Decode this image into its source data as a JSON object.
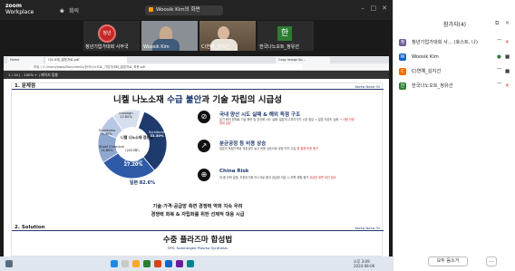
{
  "app": {
    "name": "zoom",
    "sub": "Workplace",
    "meeting_label": "회의"
  },
  "share": {
    "label": "Woosik Kim의 화면"
  },
  "videos": [
    {
      "caption": "청년기업가대회 사무국"
    },
    {
      "caption": "Woosik Kim"
    },
    {
      "caption": "C)연예_김지선"
    },
    {
      "caption": "한국나노오트_정유선",
      "initial": "한"
    }
  ],
  "browser": {
    "tabs": [
      "Home",
      "나노소재_발표자료.pdf",
      "Copy Image Sp..."
    ],
    "url": "파일 | C:/Users/papa/Documents/한국나노오트_기업가대회_발표자료_최종.pdf",
    "pdf_toolbar": "1 / 14   |   - 100% +   |   페이지 맞춤"
  },
  "slide": {
    "section1": "1. 문제점",
    "brand_logo": "Korea Nano Ot",
    "title_prefix": "니켈 나노소재 ",
    "title_hl": "수급 불안",
    "title_suffix": "과 기술 자립의 시급성",
    "donut": {
      "center_title": "니켈 나노소재 점유율",
      "center_sub": "(2023年)",
      "segments": [
        {
          "label": "Sumitomo",
          "value": "33.30%",
          "fraction": 0.333
        },
        {
          "label": "JFE Mineral",
          "value": "27.20%",
          "fraction": 0.272
        },
        {
          "label": "Shoei Chemical",
          "value": "14.80%",
          "fraction": 0.148
        },
        {
          "label": "Sumitomo",
          "value": "9.40%",
          "fraction": 0.094
        },
        {
          "label": "Luoyagn",
          "value": "13.60%",
          "fraction": 0.136
        }
      ],
      "japan_share": "일본 82.6%"
    },
    "items": [
      {
        "icon": "⊘",
        "title": "국내 양산 시도 실패 & 해외 독점 구조",
        "desc": "유기 화석 원재료 기술 확보 및 양산화 시도 실패. 일본의 고부가가치 시장 점유 = 일본 의존도 심화 →",
        "desc_red": "사용 전량 원재 일본"
      },
      {
        "icon": "↗",
        "title": "분균공정 등 비용 상승",
        "desc": "일본의 독점구조로 의존성이 높고 비용 상승으로 공정 저가 수입",
        "desc_red": "중 통해 비용 증가"
      },
      {
        "icon": "⊕",
        "title": "China Risk",
        "desc": "미·중 전략 갈등, 자원무기화 리스크로 중국 공급망 의존 시 부족 위험 증가",
        "desc_red": "공급망 재편 대안 필요"
      }
    ],
    "summary_line1": "기술·가격·공급망 측면 경쟁력 약화 지속 우려",
    "summary_line2": "경쟁력 회복 & 자립화를 위한 선제적 대응 시급",
    "section2": "2. Solution",
    "title2": "수중 플라즈마 합성법",
    "subtitle2": "SPS: Submerged Plasma Synthesis"
  },
  "taskbar": {
    "time": "오후 3:09",
    "date": "2024-08-06"
  },
  "participants": {
    "title": "참가자(4)",
    "list": [
      {
        "name": "청년기업가대회 사... (호스트, 나)",
        "initial": "청",
        "color": "#6b5b95",
        "mic": "⌒",
        "video": "✕"
      },
      {
        "name": "Woosik Kim",
        "initial": "W",
        "color": "#1565c0",
        "mic": "●",
        "video": "■"
      },
      {
        "name": "C)연예_김지선",
        "initial": "C",
        "color": "#ef6c00",
        "mic": "⌒",
        "video": "■"
      },
      {
        "name": "한국나노오트_정유선",
        "initial": "한",
        "color": "#2e7d32",
        "mic": "⌒",
        "video": "✕"
      }
    ],
    "invite_button": "모두 음소거",
    "more_button": "…"
  },
  "colors": {
    "navy": "#1f3a6d",
    "accent": "#d32f2f"
  }
}
